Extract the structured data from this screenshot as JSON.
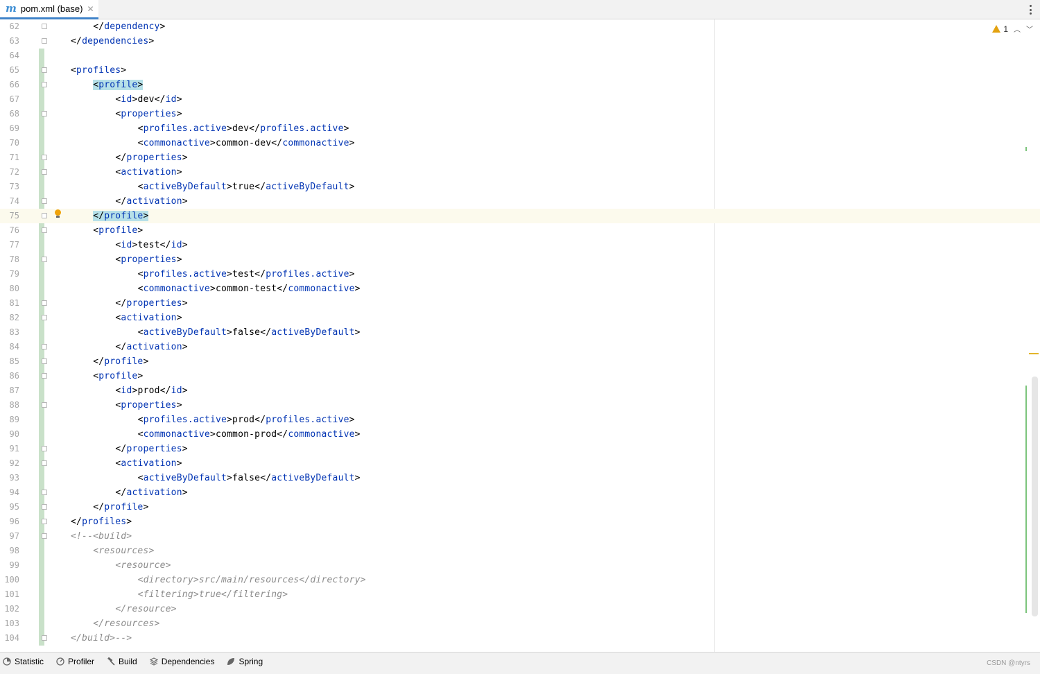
{
  "tab": {
    "title": "pom.xml (base)",
    "icon": "maven-m-icon",
    "icon_glyph": "m",
    "close_glyph": "✕"
  },
  "inspection": {
    "warning_count": "1",
    "prev_glyph": "︿",
    "next_glyph": "﹀"
  },
  "caret_line": 75,
  "lines": [
    {
      "n": "62",
      "indent": 1,
      "segs": [
        [
          "p",
          "</"
        ],
        [
          "t",
          "dependency"
        ],
        [
          "p",
          ">"
        ]
      ]
    },
    {
      "n": "63",
      "indent": 0,
      "segs": [
        [
          "p",
          "</"
        ],
        [
          "t",
          "dependencies"
        ],
        [
          "p",
          ">"
        ]
      ]
    },
    {
      "n": "64",
      "indent": 0,
      "segs": []
    },
    {
      "n": "65",
      "indent": 0,
      "segs": [
        [
          "p",
          "<"
        ],
        [
          "t",
          "profiles"
        ],
        [
          "p",
          ">"
        ]
      ]
    },
    {
      "n": "66",
      "indent": 1,
      "segs": [
        [
          "hp",
          "<"
        ],
        [
          "ht",
          "profile"
        ],
        [
          "hp",
          ">"
        ]
      ]
    },
    {
      "n": "67",
      "indent": 2,
      "segs": [
        [
          "p",
          "<"
        ],
        [
          "t",
          "id"
        ],
        [
          "p",
          ">dev</"
        ],
        [
          "t",
          "id"
        ],
        [
          "p",
          ">"
        ]
      ]
    },
    {
      "n": "68",
      "indent": 2,
      "segs": [
        [
          "p",
          "<"
        ],
        [
          "t",
          "properties"
        ],
        [
          "p",
          ">"
        ]
      ]
    },
    {
      "n": "69",
      "indent": 3,
      "segs": [
        [
          "p",
          "<"
        ],
        [
          "t",
          "profiles.active"
        ],
        [
          "p",
          ">dev</"
        ],
        [
          "t",
          "profiles.active"
        ],
        [
          "p",
          ">"
        ]
      ]
    },
    {
      "n": "70",
      "indent": 3,
      "segs": [
        [
          "p",
          "<"
        ],
        [
          "t",
          "commonactive"
        ],
        [
          "p",
          ">common-dev</"
        ],
        [
          "t",
          "commonactive"
        ],
        [
          "p",
          ">"
        ]
      ]
    },
    {
      "n": "71",
      "indent": 2,
      "segs": [
        [
          "p",
          "</"
        ],
        [
          "t",
          "properties"
        ],
        [
          "p",
          ">"
        ]
      ]
    },
    {
      "n": "72",
      "indent": 2,
      "segs": [
        [
          "p",
          "<"
        ],
        [
          "t",
          "activation"
        ],
        [
          "p",
          ">"
        ]
      ]
    },
    {
      "n": "73",
      "indent": 3,
      "segs": [
        [
          "p",
          "<"
        ],
        [
          "t",
          "activeByDefault"
        ],
        [
          "p",
          ">true</"
        ],
        [
          "t",
          "activeByDefault"
        ],
        [
          "p",
          ">"
        ]
      ]
    },
    {
      "n": "74",
      "indent": 2,
      "segs": [
        [
          "p",
          "</"
        ],
        [
          "t",
          "activation"
        ],
        [
          "p",
          ">"
        ]
      ]
    },
    {
      "n": "75",
      "indent": 1,
      "segs": [
        [
          "hp",
          "</"
        ],
        [
          "ht",
          "profile"
        ],
        [
          "hp",
          ">"
        ]
      ]
    },
    {
      "n": "76",
      "indent": 1,
      "segs": [
        [
          "p",
          "<"
        ],
        [
          "t",
          "profile"
        ],
        [
          "p",
          ">"
        ]
      ]
    },
    {
      "n": "77",
      "indent": 2,
      "segs": [
        [
          "p",
          "<"
        ],
        [
          "t",
          "id"
        ],
        [
          "p",
          ">test</"
        ],
        [
          "t",
          "id"
        ],
        [
          "p",
          ">"
        ]
      ]
    },
    {
      "n": "78",
      "indent": 2,
      "segs": [
        [
          "p",
          "<"
        ],
        [
          "t",
          "properties"
        ],
        [
          "p",
          ">"
        ]
      ]
    },
    {
      "n": "79",
      "indent": 3,
      "segs": [
        [
          "p",
          "<"
        ],
        [
          "t",
          "profiles.active"
        ],
        [
          "p",
          ">test</"
        ],
        [
          "t",
          "profiles.active"
        ],
        [
          "p",
          ">"
        ]
      ]
    },
    {
      "n": "80",
      "indent": 3,
      "segs": [
        [
          "p",
          "<"
        ],
        [
          "t",
          "commonactive"
        ],
        [
          "p",
          ">common-test</"
        ],
        [
          "t",
          "commonactive"
        ],
        [
          "p",
          ">"
        ]
      ]
    },
    {
      "n": "81",
      "indent": 2,
      "segs": [
        [
          "p",
          "</"
        ],
        [
          "t",
          "properties"
        ],
        [
          "p",
          ">"
        ]
      ]
    },
    {
      "n": "82",
      "indent": 2,
      "segs": [
        [
          "p",
          "<"
        ],
        [
          "t",
          "activation"
        ],
        [
          "p",
          ">"
        ]
      ]
    },
    {
      "n": "83",
      "indent": 3,
      "segs": [
        [
          "p",
          "<"
        ],
        [
          "t",
          "activeByDefault"
        ],
        [
          "p",
          ">false</"
        ],
        [
          "t",
          "activeByDefault"
        ],
        [
          "p",
          ">"
        ]
      ]
    },
    {
      "n": "84",
      "indent": 2,
      "segs": [
        [
          "p",
          "</"
        ],
        [
          "t",
          "activation"
        ],
        [
          "p",
          ">"
        ]
      ]
    },
    {
      "n": "85",
      "indent": 1,
      "segs": [
        [
          "p",
          "</"
        ],
        [
          "t",
          "profile"
        ],
        [
          "p",
          ">"
        ]
      ]
    },
    {
      "n": "86",
      "indent": 1,
      "segs": [
        [
          "p",
          "<"
        ],
        [
          "t",
          "profile"
        ],
        [
          "p",
          ">"
        ]
      ]
    },
    {
      "n": "87",
      "indent": 2,
      "segs": [
        [
          "p",
          "<"
        ],
        [
          "t",
          "id"
        ],
        [
          "p",
          ">prod</"
        ],
        [
          "t",
          "id"
        ],
        [
          "p",
          ">"
        ]
      ]
    },
    {
      "n": "88",
      "indent": 2,
      "segs": [
        [
          "p",
          "<"
        ],
        [
          "t",
          "properties"
        ],
        [
          "p",
          ">"
        ]
      ]
    },
    {
      "n": "89",
      "indent": 3,
      "segs": [
        [
          "p",
          "<"
        ],
        [
          "t",
          "profiles.active"
        ],
        [
          "p",
          ">prod</"
        ],
        [
          "t",
          "profiles.active"
        ],
        [
          "p",
          ">"
        ]
      ]
    },
    {
      "n": "90",
      "indent": 3,
      "segs": [
        [
          "p",
          "<"
        ],
        [
          "t",
          "commonactive"
        ],
        [
          "p",
          ">common-prod</"
        ],
        [
          "t",
          "commonactive"
        ],
        [
          "p",
          ">"
        ]
      ]
    },
    {
      "n": "91",
      "indent": 2,
      "segs": [
        [
          "p",
          "</"
        ],
        [
          "t",
          "properties"
        ],
        [
          "p",
          ">"
        ]
      ]
    },
    {
      "n": "92",
      "indent": 2,
      "segs": [
        [
          "p",
          "<"
        ],
        [
          "t",
          "activation"
        ],
        [
          "p",
          ">"
        ]
      ]
    },
    {
      "n": "93",
      "indent": 3,
      "segs": [
        [
          "p",
          "<"
        ],
        [
          "t",
          "activeByDefault"
        ],
        [
          "p",
          ">false</"
        ],
        [
          "t",
          "activeByDefault"
        ],
        [
          "p",
          ">"
        ]
      ]
    },
    {
      "n": "94",
      "indent": 2,
      "segs": [
        [
          "p",
          "</"
        ],
        [
          "t",
          "activation"
        ],
        [
          "p",
          ">"
        ]
      ]
    },
    {
      "n": "95",
      "indent": 1,
      "segs": [
        [
          "p",
          "</"
        ],
        [
          "t",
          "profile"
        ],
        [
          "p",
          ">"
        ]
      ]
    },
    {
      "n": "96",
      "indent": 0,
      "segs": [
        [
          "p",
          "</"
        ],
        [
          "t",
          "profiles"
        ],
        [
          "p",
          ">"
        ]
      ]
    },
    {
      "n": "97",
      "indent": 0,
      "segs": [
        [
          "c",
          "<!--<build>"
        ]
      ]
    },
    {
      "n": "98",
      "indent": 1,
      "segs": [
        [
          "c",
          "<resources>"
        ]
      ]
    },
    {
      "n": "99",
      "indent": 2,
      "segs": [
        [
          "c",
          "<resource>"
        ]
      ]
    },
    {
      "n": "100",
      "indent": 3,
      "segs": [
        [
          "c",
          "<directory>src/main/resources</directory>"
        ]
      ]
    },
    {
      "n": "101",
      "indent": 3,
      "segs": [
        [
          "c",
          "<filtering>true</filtering>"
        ]
      ]
    },
    {
      "n": "102",
      "indent": 2,
      "segs": [
        [
          "c",
          "</resource>"
        ]
      ]
    },
    {
      "n": "103",
      "indent": 1,
      "segs": [
        [
          "c",
          "</resources>"
        ]
      ]
    },
    {
      "n": "104",
      "indent": 0,
      "segs": [
        [
          "c",
          "</build>-->"
        ]
      ]
    }
  ],
  "fold_lines": [
    "62",
    "63",
    "65",
    "66",
    "68",
    "71",
    "72",
    "74",
    "75",
    "76",
    "78",
    "81",
    "82",
    "84",
    "85",
    "86",
    "88",
    "91",
    "92",
    "94",
    "95",
    "96",
    "97",
    "104"
  ],
  "toolbar": {
    "items": [
      {
        "label": "Statistic",
        "icon": "statistic-icon"
      },
      {
        "label": "Profiler",
        "icon": "profiler-icon"
      },
      {
        "label": "Build",
        "icon": "hammer-icon"
      },
      {
        "label": "Dependencies",
        "icon": "dependencies-icon"
      },
      {
        "label": "Spring",
        "icon": "spring-leaf-icon"
      }
    ],
    "watermark": "CSDN @ntyrs"
  },
  "colors": {
    "tag": "#0033b3",
    "comment": "#8c8c8c",
    "caret_line": "#fcfaed",
    "vcs_change": "#c9e1c9",
    "tab_accent": "#4083c9",
    "warning": "#e3a210"
  }
}
